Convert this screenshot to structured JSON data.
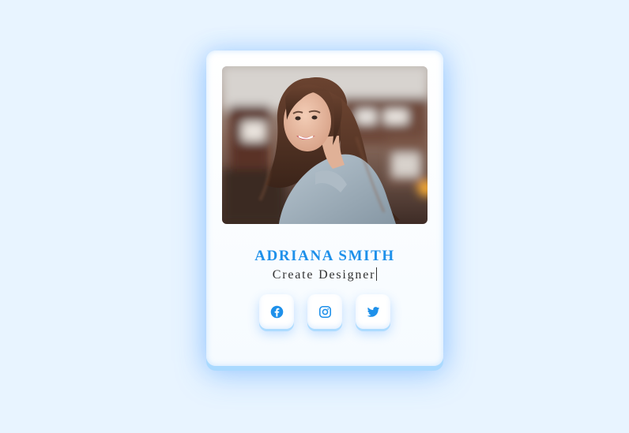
{
  "profile": {
    "name": "ADRIANA SMITH",
    "role": "Create Designer"
  },
  "socials": [
    {
      "name": "facebook",
      "icon": "facebook-icon"
    },
    {
      "name": "instagram",
      "icon": "instagram-icon"
    },
    {
      "name": "twitter",
      "icon": "twitter-icon"
    }
  ],
  "colors": {
    "page_background": "#e8f4ff",
    "card_background": "#ffffff",
    "accent": "#1e90ea",
    "role_text": "#333333",
    "card_glow": "#aadaff"
  }
}
